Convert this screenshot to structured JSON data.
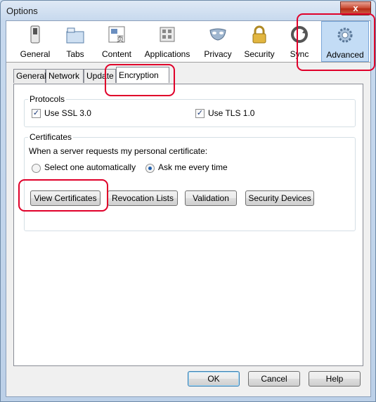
{
  "window": {
    "title": "Options",
    "close_label": "x"
  },
  "toolbar": {
    "panes": [
      {
        "label": "General",
        "icon": "general-icon"
      },
      {
        "label": "Tabs",
        "icon": "tabs-icon"
      },
      {
        "label": "Content",
        "icon": "content-icon"
      },
      {
        "label": "Applications",
        "icon": "applications-icon"
      },
      {
        "label": "Privacy",
        "icon": "privacy-mask-icon"
      },
      {
        "label": "Security",
        "icon": "lock-icon"
      },
      {
        "label": "Sync",
        "icon": "sync-icon"
      },
      {
        "label": "Advanced",
        "icon": "gear-icon",
        "selected": true
      }
    ]
  },
  "subtabs": [
    {
      "label": "General"
    },
    {
      "label": "Network"
    },
    {
      "label": "Update"
    },
    {
      "label": "Encryption",
      "active": true
    }
  ],
  "protocols": {
    "title": "Protocols",
    "ssl": {
      "label": "Use SSL 3.0",
      "checked": true
    },
    "tls": {
      "label": "Use TLS 1.0",
      "checked": true
    }
  },
  "certificates": {
    "title": "Certificates",
    "prompt": "When a server requests my personal certificate:",
    "option_auto": {
      "label": "Select one automatically",
      "selected": false
    },
    "option_ask": {
      "label": "Ask me every time",
      "selected": true
    },
    "buttons": {
      "view": "View Certificates",
      "revocation": "Revocation Lists",
      "validation": "Validation",
      "devices": "Security Devices"
    }
  },
  "footer": {
    "ok": "OK",
    "cancel": "Cancel",
    "help": "Help"
  },
  "colors": {
    "highlight": "#e0002a",
    "selected_pane": "#c3dcf5"
  }
}
